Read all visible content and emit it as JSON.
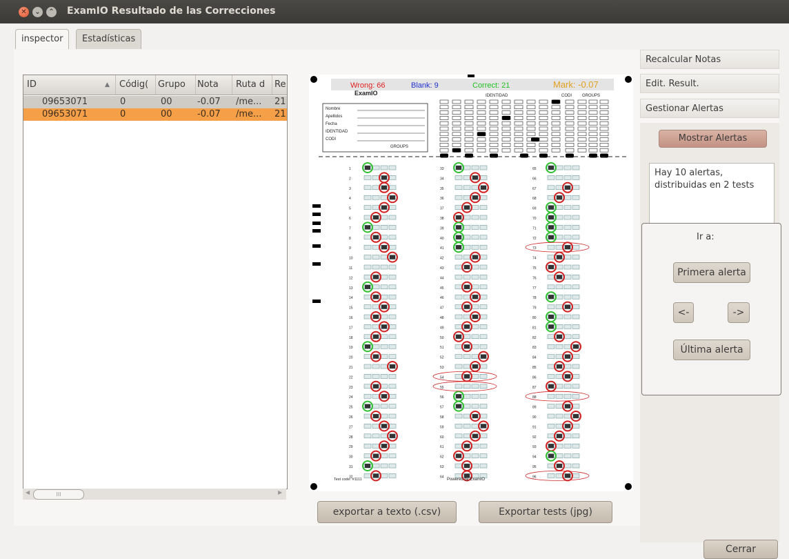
{
  "window": {
    "title": "ExamIO Resultado de las Correcciones"
  },
  "tabs": [
    {
      "label": "inspector"
    },
    {
      "label": "Estadísticas"
    }
  ],
  "table": {
    "columns": [
      "ID",
      "Códig(",
      "Grupo",
      "Nota",
      "Ruta d",
      "Re"
    ],
    "rows": [
      [
        "09653071",
        "0",
        "00",
        "-0.07",
        "/me...",
        "21"
      ],
      [
        "09653071",
        "0",
        "00",
        "-0.07",
        "/me...",
        "21"
      ]
    ],
    "scrollbar_thumb": "III"
  },
  "sheet": {
    "wrong": "Wrong: 66",
    "blank": "Blank: 9",
    "correct": "Correct: 21",
    "mark": "Mark: -0.07",
    "logo": "ExamIO",
    "identidad_header": "IDENTIDAD",
    "codi_header": "CODI",
    "groups_header": "GROUPS",
    "form_labels": [
      "Nombre",
      "Apellidos",
      "Fecha",
      "IDENTIDAD",
      "CODI"
    ],
    "groups_label": "GROUPS",
    "test_code": "Test code: #1111",
    "powered": "Powered by ExamIO",
    "colors": {
      "wrong": "#e02020",
      "blank": "#2030d0",
      "correct": "#20c020",
      "mark": "#e0a020"
    }
  },
  "actions": {
    "export_csv": "exportar a texto (.csv)",
    "export_jpg": "Exportar tests (jpg)",
    "close": "Cerrar"
  },
  "sidebar": {
    "recalcular": "Recalcular Notas",
    "edit": "Edit. Result.",
    "gestionar": "Gestionar Alertas",
    "mostrar": "Mostrar Alertas",
    "alert_text": "Hay 10 alertas, distribuidas en 2 tests",
    "ir_a": "Ir a:",
    "primera": "Primera alerta",
    "prev": "<-",
    "next": "->",
    "ultima": "Última alerta"
  }
}
